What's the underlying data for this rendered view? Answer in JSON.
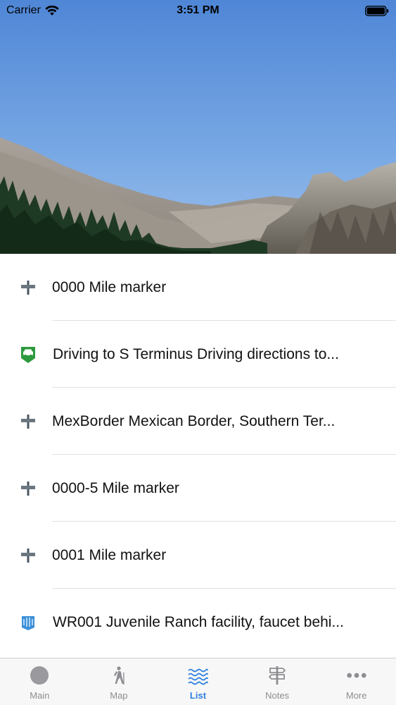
{
  "status_bar": {
    "carrier": "Carrier",
    "time": "3:51 PM",
    "icons": [
      "wifi-icon",
      "battery-icon"
    ]
  },
  "header": {
    "image": "mountain-landscape-photo"
  },
  "list": {
    "items": [
      {
        "icon": "mile-marker-icon",
        "label": "0000 Mile marker"
      },
      {
        "icon": "car-sign-icon",
        "label": "Driving to S Terminus Driving directions to..."
      },
      {
        "icon": "mile-marker-icon",
        "label": "MexBorder Mexican Border, Southern Ter..."
      },
      {
        "icon": "mile-marker-icon",
        "label": "0000-5 Mile marker"
      },
      {
        "icon": "mile-marker-icon",
        "label": "0001 Mile marker"
      },
      {
        "icon": "water-source-icon",
        "label": "WR001 Juvenile Ranch facility, faucet behi..."
      }
    ]
  },
  "tab_bar": {
    "tabs": [
      {
        "icon": "circle-icon",
        "label": "Main",
        "active": false
      },
      {
        "icon": "hiker-icon",
        "label": "Map",
        "active": false
      },
      {
        "icon": "waves-icon",
        "label": "List",
        "active": true
      },
      {
        "icon": "signpost-icon",
        "label": "Notes",
        "active": false
      },
      {
        "icon": "more-dots-icon",
        "label": "More",
        "active": false
      }
    ]
  },
  "colors": {
    "accent": "#2f7fe0",
    "inactive": "#8e8e93",
    "car_sign_green": "#2e9a3e",
    "water_blue": "#3a8fd8"
  }
}
